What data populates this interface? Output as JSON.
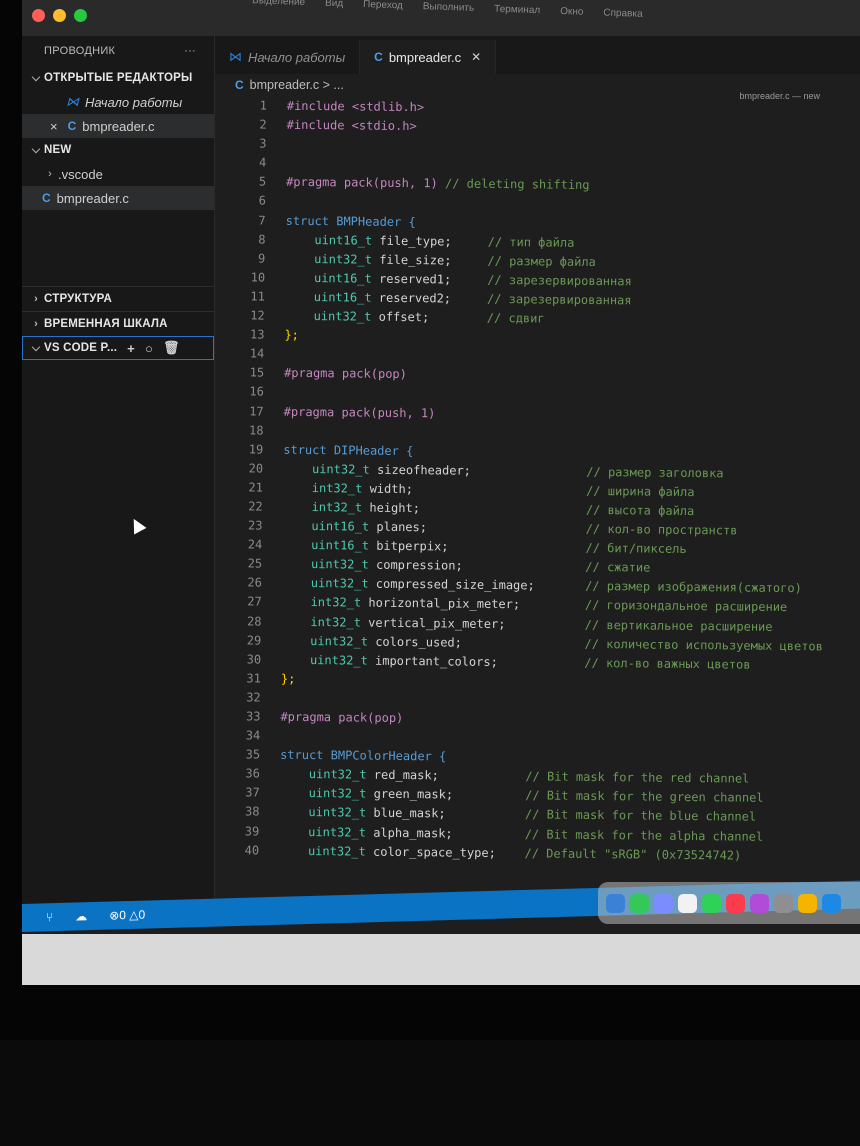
{
  "menu": [
    "Выделение",
    "Вид",
    "Переход",
    "Выполнить",
    "Терминал",
    "Окно",
    "Справка"
  ],
  "window_title": "bmpreader.c — new",
  "sidebar": {
    "header": "ПРОВОДНИК",
    "header_more": "···",
    "open_editors": "ОТКРЫТЫЕ РЕДАКТОРЫ",
    "open_items": [
      {
        "label": "Начало работы"
      },
      {
        "label": "bmpreader.c"
      }
    ],
    "folder": "NEW",
    "folder_items": [
      {
        "label": ".vscode"
      },
      {
        "label": "bmpreader.c"
      }
    ],
    "outline": "СТРУКТУРА",
    "timeline": "ВРЕМЕННАЯ ШКАЛА",
    "vscode_p": "VS CODE P..."
  },
  "tabs": [
    {
      "label": "Начало работы"
    },
    {
      "label": "bmpreader.c"
    }
  ],
  "breadcrumb": "bmpreader.c > ...",
  "code": {
    "lines": [
      {
        "n": "1"
      },
      {
        "n": "2"
      },
      {
        "n": "3"
      },
      {
        "n": "4"
      },
      {
        "n": "5"
      },
      {
        "n": "6"
      },
      {
        "n": "7"
      },
      {
        "n": "8"
      },
      {
        "n": "9"
      },
      {
        "n": "10"
      },
      {
        "n": "11"
      },
      {
        "n": "12"
      },
      {
        "n": "13"
      },
      {
        "n": "14"
      },
      {
        "n": "15"
      },
      {
        "n": "16"
      },
      {
        "n": "17"
      },
      {
        "n": "18"
      },
      {
        "n": "19"
      },
      {
        "n": "20"
      },
      {
        "n": "21"
      },
      {
        "n": "22"
      },
      {
        "n": "23"
      },
      {
        "n": "24"
      },
      {
        "n": "25"
      },
      {
        "n": "26"
      },
      {
        "n": "27"
      },
      {
        "n": "28"
      },
      {
        "n": "29"
      },
      {
        "n": "30"
      },
      {
        "n": "31"
      },
      {
        "n": "32"
      },
      {
        "n": "33"
      },
      {
        "n": "34"
      },
      {
        "n": "35"
      },
      {
        "n": "36"
      },
      {
        "n": "37"
      },
      {
        "n": "38"
      },
      {
        "n": "39"
      },
      {
        "n": "40"
      }
    ],
    "l1": "#include <stdlib.h>",
    "l2": "#include <stdio.h>",
    "l5_a": "#pragma pack(push, 1)",
    "l5_c": "// deleting shifting",
    "l7": "struct BMPHeader {",
    "bmp_fields": [
      {
        "t": "uint16_t",
        "f": "file_type;",
        "c": "// тип файла"
      },
      {
        "t": "uint32_t",
        "f": "file_size;",
        "c": "// размер файла"
      },
      {
        "t": "uint16_t",
        "f": "reserved1;",
        "c": "// зарезервированная"
      },
      {
        "t": "uint16_t",
        "f": "reserved2;",
        "c": "// зарезервированная"
      },
      {
        "t": "uint32_t",
        "f": "offset;",
        "c": "// сдвиг"
      }
    ],
    "close": "};",
    "pop": "#pragma pack(pop)",
    "push": "#pragma pack(push, 1)",
    "l19": "struct DIPHeader {",
    "dip_fields": [
      {
        "t": "uint32_t",
        "f": "sizeofheader;",
        "c": "// размер заголовка"
      },
      {
        "t": "int32_t",
        "f": "width;",
        "c": "// ширина файла"
      },
      {
        "t": "int32_t",
        "f": "height;",
        "c": "// высота файла"
      },
      {
        "t": "uint16_t",
        "f": "planes;",
        "c": "// кол-во пространств"
      },
      {
        "t": "uint16_t",
        "f": "bitperpix;",
        "c": "// бит/пиксель"
      },
      {
        "t": "uint32_t",
        "f": "compression;",
        "c": "// сжатие"
      },
      {
        "t": "uint32_t",
        "f": "compressed_size_image;",
        "c": "// размер изображения(сжатого)"
      },
      {
        "t": "int32_t",
        "f": "horizontal_pix_meter;",
        "c": "// горизондальное расширение"
      },
      {
        "t": "int32_t",
        "f": "vertical_pix_meter;",
        "c": "// вертикальное расширение"
      },
      {
        "t": "uint32_t",
        "f": "colors_used;",
        "c": "// количество используемых цветов"
      },
      {
        "t": "uint32_t",
        "f": "important_colors;",
        "c": "// кол-во важных цветов"
      }
    ],
    "l35": "struct BMPColorHeader {",
    "color_fields": [
      {
        "t": "uint32_t",
        "f": "red_mask;",
        "c": "// Bit mask for the red channel"
      },
      {
        "t": "uint32_t",
        "f": "green_mask;",
        "c": "// Bit mask for the green channel"
      },
      {
        "t": "uint32_t",
        "f": "blue_mask;",
        "c": "// Bit mask for the blue channel"
      },
      {
        "t": "uint32_t",
        "f": "alpha_mask;",
        "c": "// Bit mask for the alpha channel"
      },
      {
        "t": "uint32_t",
        "f": "color_space_type;",
        "c": "// Default \"sRGB\" (0x73524742)"
      }
    ]
  },
  "status": {
    "errors": "0",
    "warnings": "0"
  },
  "colors": {
    "accent": "#0a73c4",
    "red": "#ff5f57",
    "yellow": "#febc2e",
    "green": "#28c840"
  }
}
